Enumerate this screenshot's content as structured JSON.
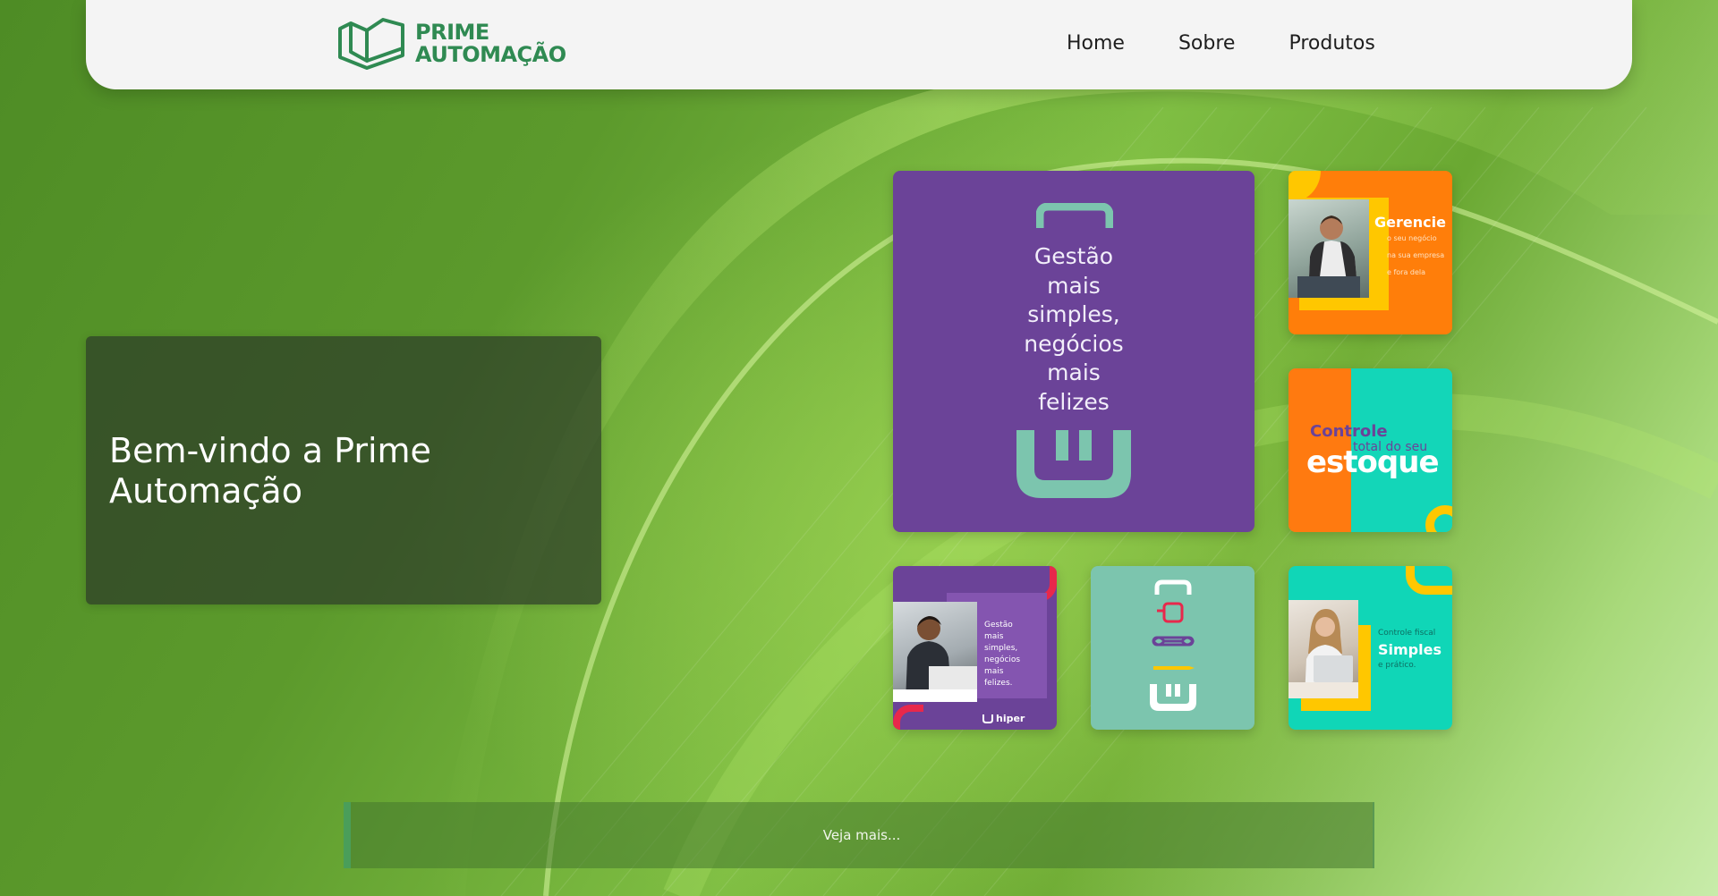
{
  "brand": {
    "line1": "PRIME",
    "line2": "AUTOMAÇÃO",
    "color": "#2f8a52"
  },
  "nav": {
    "items": [
      {
        "label": "Home"
      },
      {
        "label": "Sobre"
      },
      {
        "label": "Produtos"
      }
    ]
  },
  "hero": {
    "title": "Bem-vindo a Prime Automação"
  },
  "gallery": {
    "main": {
      "lines": [
        "Gestão",
        "mais",
        "simples,",
        "negócios",
        "mais",
        "felizes"
      ],
      "bg": "#6b4398"
    },
    "gerencie": {
      "title": "Gerencie",
      "sub1": "o seu negócio",
      "sub2": "na sua empresa",
      "sub3": "e fora dela"
    },
    "estoque": {
      "line1": "Controle",
      "line2": "total do seu",
      "line3": "estoque"
    },
    "gestao_small": {
      "lines": [
        "Gestão",
        "mais",
        "simples,",
        "negócios",
        "mais",
        "felizes."
      ],
      "brand": "hiper"
    },
    "fiscal": {
      "line1": "Controle fiscal",
      "line2": "Simples",
      "line3": "e prático."
    }
  },
  "cta": {
    "label": "Veja mais..."
  }
}
